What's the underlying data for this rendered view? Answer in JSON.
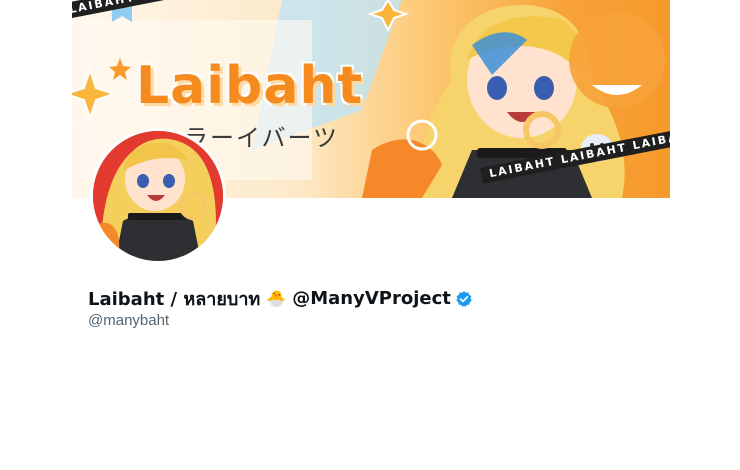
{
  "banner": {
    "title": "Laibaht",
    "subtitle": "ラーイバーツ",
    "tape_text": "LAIBAHT LAIBAHT LAIBAHT LAIBAHT",
    "accent_color": "#f7a23a"
  },
  "profile": {
    "display_name": "Laibaht / หลายบาท",
    "name_emoji": "🐣",
    "group_name": "@ManyVProject",
    "handle": "@manybaht",
    "verified_color": "#1d9bf0"
  }
}
